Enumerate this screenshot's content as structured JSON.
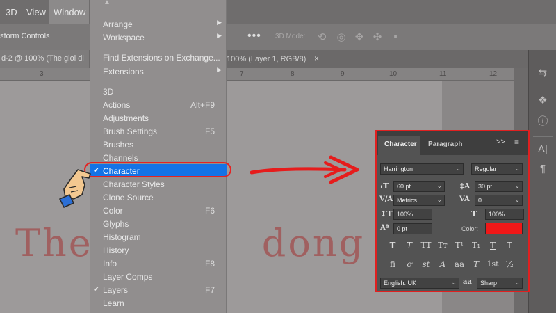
{
  "menubar": {
    "items": [
      "3D",
      "View",
      "Window"
    ]
  },
  "options_bar": {
    "tool_label": "sform Controls",
    "mode_3d": "3D Mode:"
  },
  "tabs": {
    "doc_tab_1": "d-2 @ 100% (The gioi di",
    "doc_tab_2": "100% (Layer 1, RGB/8)",
    "close_glyph": "×"
  },
  "ruler": {
    "ticks": [
      "3",
      "7",
      "8",
      "9",
      "10",
      "11",
      "12"
    ]
  },
  "canvas": {
    "text_left": "The",
    "text_right": "dong"
  },
  "window_menu": {
    "items": [
      {
        "label": "Arrange",
        "submenu": true
      },
      {
        "label": "Workspace",
        "submenu": true
      },
      {
        "label": "Find Extensions on Exchange..."
      },
      {
        "label": "Extensions",
        "submenu": true
      },
      {
        "label": "3D"
      },
      {
        "label": "Actions",
        "shortcut": "Alt+F9"
      },
      {
        "label": "Adjustments"
      },
      {
        "label": "Brush Settings",
        "shortcut": "F5"
      },
      {
        "label": "Brushes"
      },
      {
        "label": "Channels"
      },
      {
        "label": "Character",
        "checked": true,
        "highlighted": true
      },
      {
        "label": "Character Styles"
      },
      {
        "label": "Clone Source"
      },
      {
        "label": "Color",
        "shortcut": "F6"
      },
      {
        "label": "Glyphs"
      },
      {
        "label": "Histogram"
      },
      {
        "label": "History"
      },
      {
        "label": "Info",
        "shortcut": "F8"
      },
      {
        "label": "Layer Comps"
      },
      {
        "label": "Layers",
        "shortcut": "F7",
        "checked": true
      },
      {
        "label": "Learn"
      }
    ]
  },
  "character_panel": {
    "tab_character": "Character",
    "tab_paragraph": "Paragraph",
    "collapse_glyph": ">>",
    "font_family": "Harrington",
    "font_style": "Regular",
    "font_size": "60 pt",
    "leading": "30 pt",
    "kerning": "Metrics",
    "tracking": "0",
    "vertical_scale": "100%",
    "horizontal_scale": "100%",
    "baseline_shift": "0 pt",
    "color_label": "Color:",
    "color_value": "#f01818",
    "style_buttons": [
      "T",
      "T",
      "TT",
      "Tт",
      "T¹",
      "T₁",
      "T",
      "T"
    ],
    "opentype_buttons": [
      "fi",
      "ơ",
      "st",
      "A",
      "aa",
      "T",
      "1st",
      "½"
    ],
    "language": "English: UK",
    "aa_glyph": "aa",
    "antialias": "Sharp"
  },
  "colors": {
    "highlight": "#1473e6",
    "annotation_red": "#e02020"
  }
}
